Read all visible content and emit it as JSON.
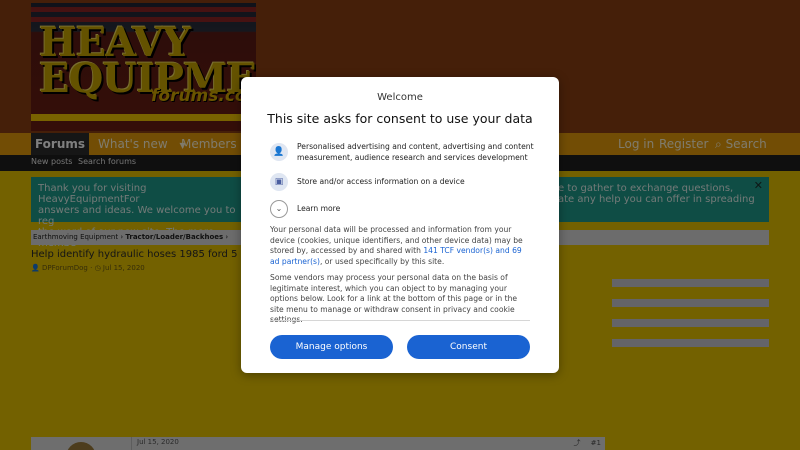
{
  "logo": {
    "line1": "HEAVY",
    "line2": "EQUIPMENT",
    "sub": "forums.com"
  },
  "nav": {
    "forums": "Forums",
    "whats_new": "What's new",
    "members": "Members",
    "login": "Log in",
    "register": "Register",
    "search": "Search"
  },
  "subnav": {
    "new_posts": "New posts",
    "search_forums": "Search forums"
  },
  "notice": {
    "left_text": "Thank you for visiting HeavyEquipmentFor\nanswers and ideas. We welcome you to reg\nthe word of our new site. The more membe",
    "right_text": "e to gather to exchange questions,\nate any help you can offer in spreading",
    "close": "✕"
  },
  "breadcrumbs": {
    "item1": "Earthmoving Equipment",
    "item2": "Tractor/Loader/Backhoes"
  },
  "thread": {
    "title": "Help identify hydraulic hoses 1985 ford 5",
    "author": "DPForumDog",
    "date": "Jul 15, 2020"
  },
  "post": {
    "date": "Jul 15, 2020",
    "number": "#1"
  },
  "consent": {
    "welcome": "Welcome",
    "title": "This site asks for consent to use your data",
    "purpose1": "Personalised advertising and content, advertising and content measurement, audience research and services development",
    "purpose2": "Store and/or access information on a device",
    "learn_more": "Learn more",
    "body1_before": "Your personal data will be processed and information from your device (cookies, unique identifiers, and other device data) may be stored by, accessed by and shared with ",
    "body1_link": "141 TCF vendor(s) and 69 ad partner(s)",
    "body1_after": ", or used specifically by this site.",
    "body2": "Some vendors may process your personal data on the basis of legitimate interest, which you can object to by managing your options below. Look for a link at the bottom of this page or in the site menu to manage or withdraw consent in privacy and cookie settings.",
    "manage_options": "Manage options",
    "consent_button": "Consent"
  },
  "colors": {
    "header_brown": "#8a3e12",
    "nav_orange": "#e49a0b",
    "page_yellow": "#e6c200",
    "notice_teal": "#1f9b8b",
    "consent_blue": "#1a63d2"
  }
}
